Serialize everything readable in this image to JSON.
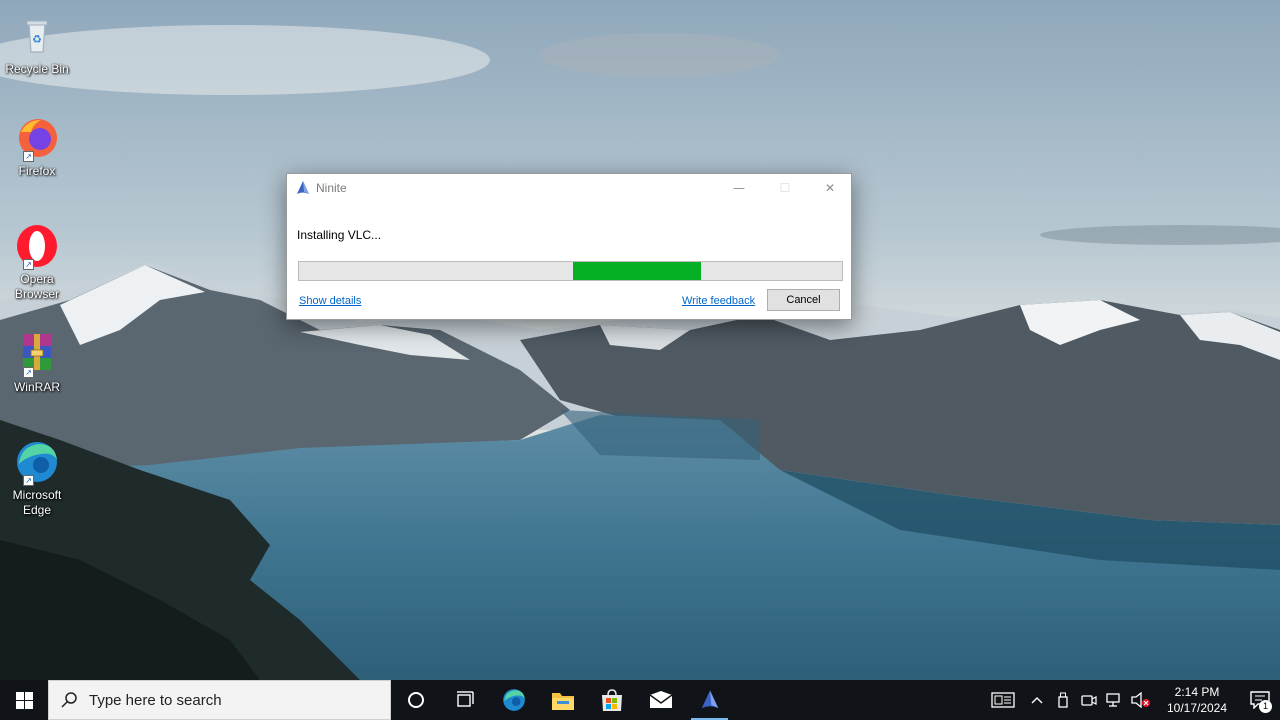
{
  "desktop": {
    "icons": [
      {
        "label": "Recycle Bin",
        "icon": "recycle-bin-icon"
      },
      {
        "label": "Firefox",
        "icon": "firefox-icon"
      },
      {
        "label": "Opera Browser",
        "icon": "opera-icon"
      },
      {
        "label": "WinRAR",
        "icon": "winrar-icon"
      },
      {
        "label": "Microsoft Edge",
        "icon": "edge-icon"
      }
    ]
  },
  "dialog": {
    "title": "Ninite",
    "status": "Installing VLC...",
    "progress": {
      "start_fraction": 0.505,
      "end_fraction": 0.74,
      "fill_color": "#06b025"
    },
    "show_details_label": "Show details",
    "write_feedback_label": "Write feedback",
    "cancel_label": "Cancel",
    "min_glyph": "—",
    "max_glyph": "☐",
    "close_glyph": "✕"
  },
  "taskbar": {
    "search_placeholder": "Type here to search",
    "apps": [
      {
        "name": "Cortana",
        "icon": "cortana-icon"
      },
      {
        "name": "Task View",
        "icon": "task-view-icon"
      },
      {
        "name": "Microsoft Edge",
        "icon": "edge-icon"
      },
      {
        "name": "File Explorer",
        "icon": "file-explorer-icon"
      },
      {
        "name": "Microsoft Store",
        "icon": "store-icon"
      },
      {
        "name": "Mail",
        "icon": "mail-icon"
      },
      {
        "name": "Ninite",
        "icon": "ninite-icon",
        "active": true
      }
    ],
    "clock": {
      "time": "2:14 PM",
      "date": "10/17/2024"
    },
    "notification_count": "1",
    "accent_color": "#76b9ed"
  }
}
